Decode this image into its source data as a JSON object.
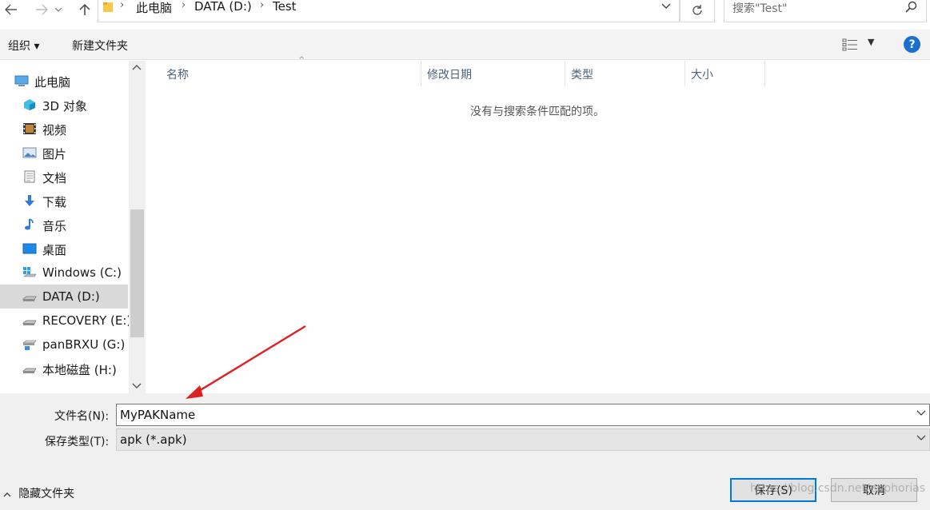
{
  "nav": {
    "breadcrumbs": [
      "此电脑",
      "DATA (D:)",
      "Test"
    ],
    "search_placeholder": "搜索\"Test\""
  },
  "toolbar": {
    "organize": "组织 ▾",
    "new_folder": "新建文件夹"
  },
  "sidebar": {
    "items": [
      {
        "label": "此电脑",
        "icon": "computer-icon"
      },
      {
        "label": "3D 对象",
        "icon": "3d-objects-icon"
      },
      {
        "label": "视频",
        "icon": "video-icon"
      },
      {
        "label": "图片",
        "icon": "pictures-icon"
      },
      {
        "label": "文档",
        "icon": "documents-icon"
      },
      {
        "label": "下载",
        "icon": "download-icon"
      },
      {
        "label": "音乐",
        "icon": "music-icon"
      },
      {
        "label": "桌面",
        "icon": "desktop-icon"
      },
      {
        "label": "Windows (C:)",
        "icon": "windows-drive-icon"
      },
      {
        "label": "DATA (D:)",
        "icon": "drive-icon",
        "selected": true
      },
      {
        "label": "RECOVERY (E:)",
        "icon": "drive-icon"
      },
      {
        "label": "panBRXU (G:)",
        "icon": "network-drive-icon"
      },
      {
        "label": "本地磁盘 (H:)",
        "icon": "drive-icon"
      }
    ]
  },
  "filelist": {
    "columns": [
      "名称",
      "修改日期",
      "类型",
      "大小"
    ],
    "empty_message": "没有与搜索条件匹配的项。"
  },
  "form": {
    "filename_label": "文件名(N):",
    "filename_value": "MyPAKName",
    "filetype_label": "保存类型(T):",
    "filetype_value": "apk (*.apk)"
  },
  "footer": {
    "hide_folders": "隐藏文件夹",
    "save": "保存(S)",
    "cancel": "取消",
    "watermark": "https://blog.csdn.net/euphorias"
  },
  "colors": {
    "accent": "#0078d7",
    "arrow": "#e02020",
    "help": "#1b6fd1"
  }
}
